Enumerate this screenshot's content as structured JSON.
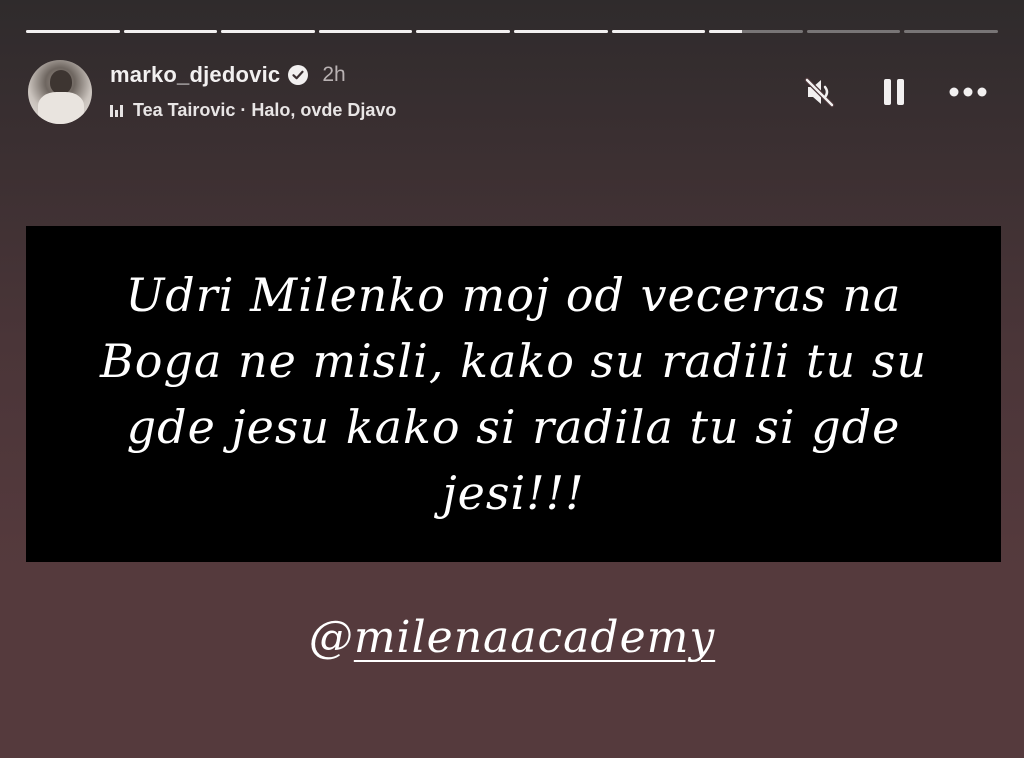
{
  "progress": {
    "segments": [
      {
        "fill": 1
      },
      {
        "fill": 1
      },
      {
        "fill": 1
      },
      {
        "fill": 1
      },
      {
        "fill": 1
      },
      {
        "fill": 1
      },
      {
        "fill": 1
      },
      {
        "fill": 0.35
      },
      {
        "fill": 0
      },
      {
        "fill": 0
      }
    ]
  },
  "header": {
    "username": "marko_djedovic",
    "verified": true,
    "time": "2h",
    "music": "Tea Tairovic · Halo, ovde Djavo"
  },
  "controls": {
    "mute_icon": "speaker-muted-icon",
    "pause_icon": "pause-icon",
    "more_icon": "more-horizontal-icon"
  },
  "story": {
    "quote": "Udri Milenko moj od veceras na Boga ne misli, kako su radili tu su gde jesu kako si radila tu si gde jesi!!!",
    "mention_prefix": "@",
    "mention_handle": "milenaacademy"
  },
  "colors": {
    "background": "#553a3d",
    "quote_box": "#000000",
    "text": "#ffffff"
  }
}
